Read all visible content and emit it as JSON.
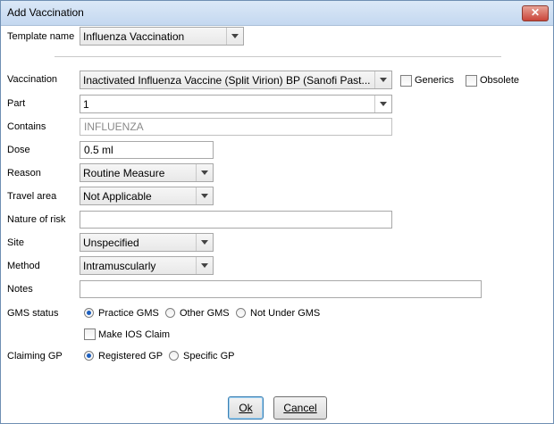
{
  "window": {
    "title": "Add Vaccination",
    "close_glyph": "✕"
  },
  "template": {
    "label": "Template name",
    "value": "Influenza Vaccination"
  },
  "vaccination": {
    "label": "Vaccination",
    "value": "Inactivated Influenza Vaccine (Split Virion) BP (Sanofi Past...",
    "generics_label": "Generics",
    "obsolete_label": "Obsolete",
    "generics_checked": false,
    "obsolete_checked": false
  },
  "part": {
    "label": "Part",
    "value": "1"
  },
  "contains": {
    "label": "Contains",
    "value": "INFLUENZA"
  },
  "dose": {
    "label": "Dose",
    "value": "0.5 ml"
  },
  "reason": {
    "label": "Reason",
    "value": "Routine Measure"
  },
  "travel_area": {
    "label": "Travel area",
    "value": "Not Applicable"
  },
  "nature_of_risk": {
    "label": "Nature of risk",
    "value": ""
  },
  "site": {
    "label": "Site",
    "value": "Unspecified"
  },
  "method": {
    "label": "Method",
    "value": "Intramuscularly"
  },
  "notes": {
    "label": "Notes",
    "value": ""
  },
  "gms_status": {
    "label": "GMS status",
    "options": [
      "Practice GMS",
      "Other GMS",
      "Not Under GMS"
    ],
    "selected": "Practice GMS"
  },
  "ios_claim": {
    "label": "Make IOS Claim",
    "checked": false
  },
  "claiming_gp": {
    "label": "Claiming GP",
    "options": [
      "Registered GP",
      "Specific GP"
    ],
    "selected": "Registered GP"
  },
  "buttons": {
    "ok": "Ok",
    "cancel": "Cancel"
  },
  "colors": {
    "title_bar": "#c4d8f0",
    "close_button": "#c9453a",
    "radio_selected": "#1c5fbf"
  }
}
